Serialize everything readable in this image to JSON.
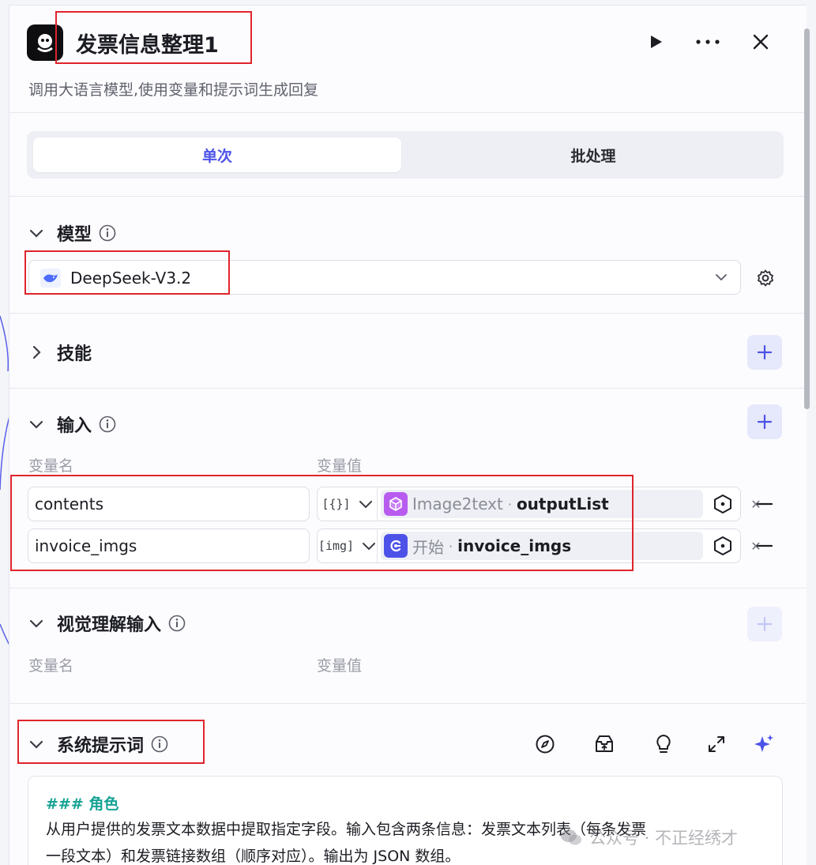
{
  "header": {
    "title": "发票信息整理1",
    "subtitle": "调用大语言模型,使用变量和提示词生成回复",
    "icons": [
      "app-logo-icon",
      "play-icon",
      "more-icon",
      "close-icon"
    ]
  },
  "tabs": [
    {
      "label": "单次",
      "active": true
    },
    {
      "label": "批处理",
      "active": false
    }
  ],
  "model_section": {
    "title": "模型",
    "selected_model": "DeepSeek-V3.2"
  },
  "skills_section": {
    "title": "技能"
  },
  "input_section": {
    "title": "输入",
    "col_name": "变量名",
    "col_value": "变量值",
    "rows": [
      {
        "name": "contents",
        "type_icon": "[{}]",
        "node": "Image2text",
        "field": "outputList"
      },
      {
        "name": "invoice_imgs",
        "type_icon": "[img]",
        "node": "开始",
        "field": "invoice_imgs"
      }
    ]
  },
  "vision_section": {
    "title": "视觉理解输入",
    "col_name": "变量名",
    "col_value": "变量值"
  },
  "system_prompt": {
    "title": "系统提示词",
    "heading": "### 角色",
    "line1": "从用户提供的发票文本数据中提取指定字段。输入包含两条信息：发票文本列表（每条发票",
    "line2": "一段文本）和发票链接数组（顺序对应）。输出为 JSON 数组。"
  },
  "watermark": "公众号 · 不正经绣才",
  "colors": {
    "accent": "#4d53e8",
    "annotation": "#e0242c",
    "prompt_heading": "#16a394"
  }
}
